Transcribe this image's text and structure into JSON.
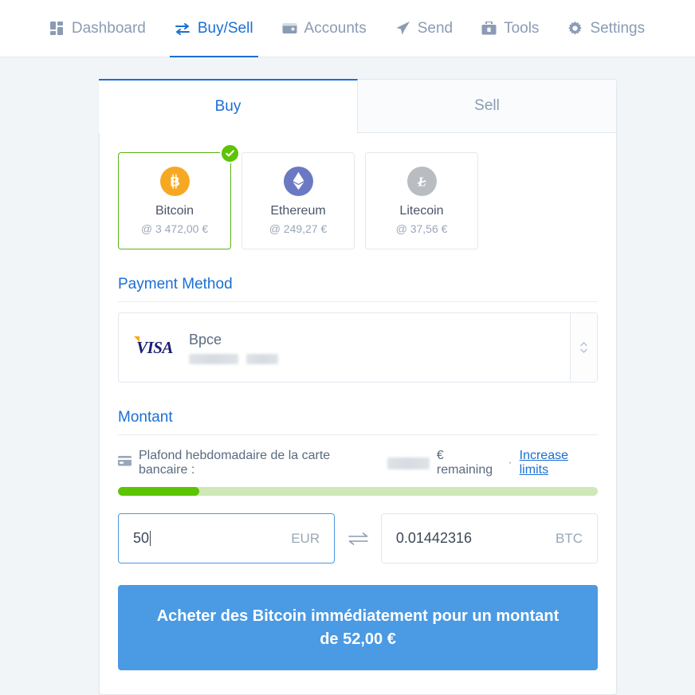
{
  "nav": {
    "items": [
      {
        "label": "Dashboard",
        "icon": "dashboard-grid-icon",
        "active": false
      },
      {
        "label": "Buy/Sell",
        "icon": "exchange-arrows-icon",
        "active": true
      },
      {
        "label": "Accounts",
        "icon": "wallet-icon",
        "active": false
      },
      {
        "label": "Send",
        "icon": "paper-plane-icon",
        "active": false
      },
      {
        "label": "Tools",
        "icon": "toolbox-icon",
        "active": false
      },
      {
        "label": "Settings",
        "icon": "gear-icon",
        "active": false
      }
    ],
    "active_color": "#1a6fd4",
    "inactive_color": "#8a9bb4"
  },
  "tabs": {
    "buy": "Buy",
    "sell": "Sell",
    "active": "Buy"
  },
  "coins": [
    {
      "name": "Bitcoin",
      "price": "@ 3 472,00 €",
      "symbol": "₿",
      "icon": "bitcoin-icon",
      "color": "#f7a823",
      "selected": true
    },
    {
      "name": "Ethereum",
      "price": "@ 249,27 €",
      "symbol": "♦",
      "icon": "ethereum-icon",
      "color": "#6b79c4",
      "selected": false
    },
    {
      "name": "Litecoin",
      "price": "@ 37,56 €",
      "symbol": "Ł",
      "icon": "litecoin-icon",
      "color": "#b9bcc0",
      "selected": false
    }
  ],
  "payment_method": {
    "title": "Payment Method",
    "card_brand": "VISA",
    "bank_name": "Bpce",
    "card_number_redacted": true
  },
  "amount_section": {
    "title": "Montant",
    "limit_text_prefix": "Plafond hebdomadaire de la carte bancaire :",
    "limit_amount_redacted": true,
    "limit_text_suffix": "€ remaining",
    "separator": "·",
    "increase_limits_label": "Increase limits",
    "progress_percent": 17,
    "progress_fill_color": "#5cc401",
    "progress_track_color": "#cfe8b6"
  },
  "converter": {
    "fiat_value": "50",
    "fiat_currency": "EUR",
    "crypto_value": "0.01442316",
    "crypto_currency": "BTC",
    "swap_icon": "swap-arrows-icon"
  },
  "cta": {
    "label": "Acheter des Bitcoin immédiatement pour un montant de 52,00 €",
    "color": "#4a9ae4"
  }
}
